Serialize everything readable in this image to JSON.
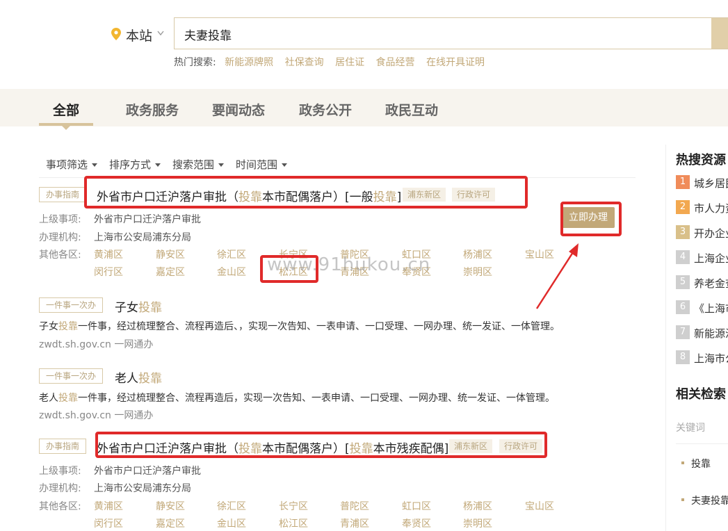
{
  "header": {
    "location_label": "本站",
    "search_value": "夫妻投靠",
    "hot_label": "热门搜索:",
    "hot_links": [
      "新能源牌照",
      "社保查询",
      "居住证",
      "食品经营",
      "在线开具证明"
    ]
  },
  "tabs": [
    "全部",
    "政务服务",
    "要闻动态",
    "政务公开",
    "政民互动"
  ],
  "filters": [
    "事项筛选",
    "排序方式",
    "搜索范围",
    "时间范围"
  ],
  "results": [
    {
      "tag": "办事指南",
      "title_parts": [
        "外省市户口迁沪落户审批（",
        "投靠",
        "本市配偶落户）[一般",
        "投靠",
        "]"
      ],
      "badges": [
        "浦东新区",
        "行政许可"
      ],
      "parent_label": "上级事项:",
      "parent_value": "外省市户口迁沪落户审批",
      "org_label": "办理机构:",
      "org_value": "上海市公安局浦东分局",
      "other_label": "其他各区:",
      "districts_row1": [
        "黄浦区",
        "静安区",
        "徐汇区",
        "长宁区",
        "普陀区",
        "虹口区",
        "杨浦区",
        "宝山区"
      ],
      "districts_row2": [
        "闵行区",
        "嘉定区",
        "金山区",
        "松江区",
        "青浦区",
        "奉贤区",
        "崇明区"
      ],
      "apply_label": "立即办理"
    },
    {
      "tag": "一件事一次办",
      "title_parts": [
        "子女",
        "投靠"
      ],
      "desc_parts": [
        "子女",
        "投靠",
        "一件事，经过梳理整合、流程再造后、，实现一次告知、一表申请、一口受理、一网办理、统一发证、一体管理。"
      ],
      "source": "zwdt.sh.gov.cn    一网通办"
    },
    {
      "tag": "一件事一次办",
      "title_parts": [
        "老人",
        "投靠"
      ],
      "desc_parts": [
        "老人",
        "投靠",
        "一件事，经过梳理整合、流程再造后，实现一次告知、一表申请、一口受理、一网办理、统一发证、一体管理。"
      ],
      "source": "zwdt.sh.gov.cn    一网通办"
    },
    {
      "tag": "办事指南",
      "title_parts": [
        "外省市户口迁沪落户审批（",
        "投靠",
        "本市配偶落户）[",
        "投靠",
        "本市残疾配偶]"
      ],
      "badges": [
        "浦东新区",
        "行政许可"
      ],
      "parent_label": "上级事项:",
      "parent_value": "外省市户口迁沪落户审批",
      "org_label": "办理机构:",
      "org_value": "上海市公安局浦东分局",
      "other_label": "其他各区:",
      "districts_row1": [
        "黄浦区",
        "静安区",
        "徐汇区",
        "长宁区",
        "普陀区",
        "虹口区",
        "杨浦区",
        "宝山区"
      ],
      "districts_row2": [
        "闵行区",
        "嘉定区",
        "金山区",
        "松江区",
        "青浦区",
        "奉贤区",
        "崇明区"
      ]
    }
  ],
  "watermark": "www.91hukou.cn",
  "sidebar": {
    "hot_title": "热搜资源",
    "hot_items": [
      {
        "rank": "1",
        "text": "城乡居民",
        "color": "#f08c5a"
      },
      {
        "rank": "2",
        "text": "市人力资",
        "color": "#f2a850"
      },
      {
        "rank": "3",
        "text": "开办企业",
        "color": "#d9c08a"
      },
      {
        "rank": "4",
        "text": "上海企业",
        "color": "#cfcfcf"
      },
      {
        "rank": "5",
        "text": "养老金查",
        "color": "#cfcfcf"
      },
      {
        "rank": "6",
        "text": "《上海市",
        "color": "#cfcfcf"
      },
      {
        "rank": "7",
        "text": "新能源汽",
        "color": "#cfcfcf"
      },
      {
        "rank": "8",
        "text": "上海市公",
        "color": "#cfcfcf"
      }
    ],
    "related_title": "相关检索",
    "keyword_label": "关键词",
    "related_items": [
      "投靠",
      "夫妻投靠"
    ]
  },
  "colors": {
    "accent": "#c2a878",
    "highlight_box": "#e02a2a"
  }
}
